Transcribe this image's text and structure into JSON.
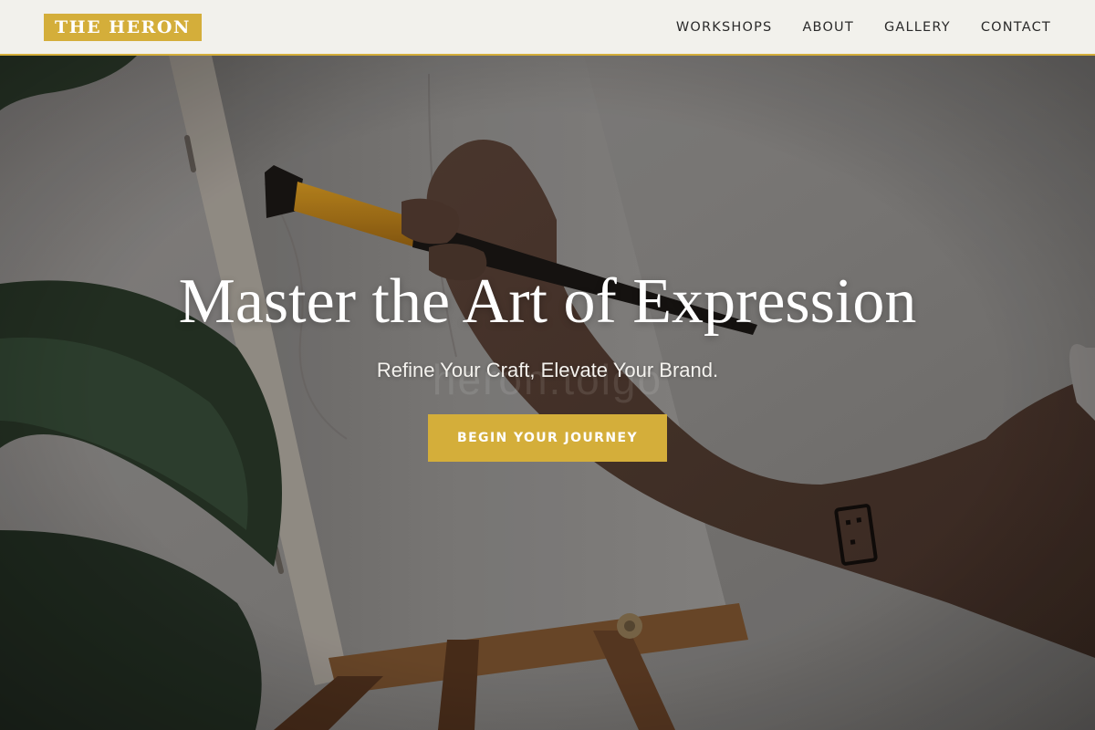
{
  "brand": {
    "logo_text": "THE HERON"
  },
  "nav": {
    "items": [
      {
        "label": "WORKSHOPS"
      },
      {
        "label": "ABOUT"
      },
      {
        "label": "GALLERY"
      },
      {
        "label": "CONTACT"
      }
    ]
  },
  "hero": {
    "title": "Master the Art of Expression",
    "subtitle": "Refine Your Craft, Elevate Your Brand.",
    "cta_label": "BEGIN YOUR JOURNEY",
    "watermark": "heron.tolgo",
    "image_subject": "hand painting a canvas on a wooden easel beside a plant"
  },
  "colors": {
    "accent": "#d4ae3a",
    "header_bg": "#f2f1ec",
    "nav_text": "#2a2a2a",
    "hero_text": "#ffffff"
  }
}
